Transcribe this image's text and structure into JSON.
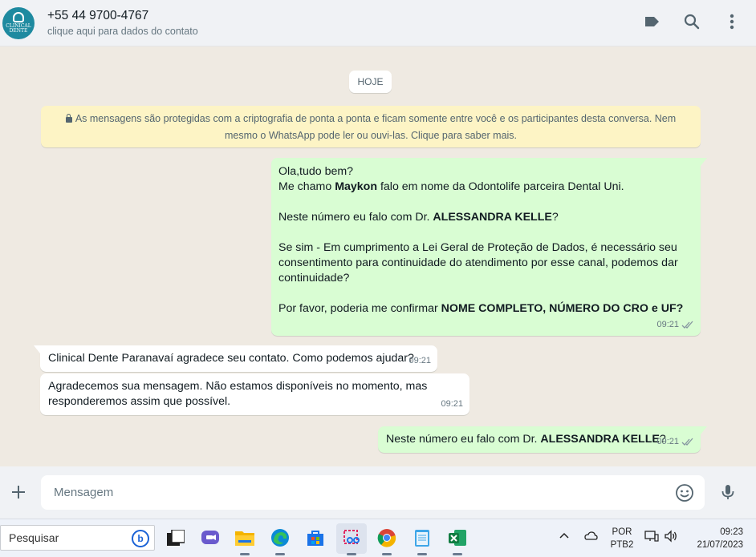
{
  "header": {
    "avatar_text": "CLINICAL DENTE",
    "contact_name": "+55 44 9700-4767",
    "contact_subtitle": "clique aqui para dados do contato",
    "icons": [
      "label-icon",
      "search-icon",
      "more-vert-icon"
    ]
  },
  "chat": {
    "date_chip": "HOJE",
    "encryption_notice": "As mensagens são protegidas com a criptografia de ponta a ponta e ficam somente entre você e os participantes desta conversa. Nem mesmo o WhatsApp pode ler ou ouvi-las. Clique para saber mais.",
    "messages": [
      {
        "direction": "out",
        "lines": {
          "l1": "Ola,tudo bem?",
          "l2_pre": "Me chamo ",
          "l2_bold": "Maykon",
          "l2_post": " falo em nome da Odontolife parceira Dental Uni.",
          "l3_pre": "Neste número eu falo com Dr. ",
          "l3_bold": "ALESSANDRA KELLE",
          "l3_post": "?",
          "l4a": "Se sim - Em cumprimento a Lei Geral de Proteção de Dados, é necessário seu",
          "l4b": "consentimento para continuidade do atendimento por esse canal, podemos dar",
          "l4c": "continuidade?",
          "l5_pre": "Por favor, poderia me confirmar ",
          "l5_bold": "NOME COMPLETO, NÚMERO DO CRO e UF?"
        },
        "time": "09:21",
        "status": "delivered"
      },
      {
        "direction": "in",
        "text": "Clinical Dente Paranavaí agradece seu contato. Como podemos ajudar?",
        "time": "09:21"
      },
      {
        "direction": "in",
        "text_line1": "Agradecemos sua mensagem. Não estamos disponíveis no momento, mas",
        "text_line2": "responderemos assim que possível.",
        "time": "09:21"
      },
      {
        "direction": "out",
        "text_pre": "Neste número eu falo com Dr. ",
        "text_bold": "ALESSANDRA KELLE",
        "text_post": "?",
        "time": "09:21",
        "status": "delivered"
      }
    ]
  },
  "composer": {
    "placeholder": "Mensagem"
  },
  "taskbar": {
    "search_label": "Pesquisar",
    "lang_top": "POR",
    "lang_bottom": "PTB2",
    "time": "09:23",
    "date": "21/07/2023"
  },
  "colors": {
    "outgoing_bubble": "#d9fdd3",
    "incoming_bubble": "#ffffff",
    "chat_background": "#efeae2",
    "encryption_banner": "#fdf4c5",
    "avatar": "#1e8aa0"
  }
}
